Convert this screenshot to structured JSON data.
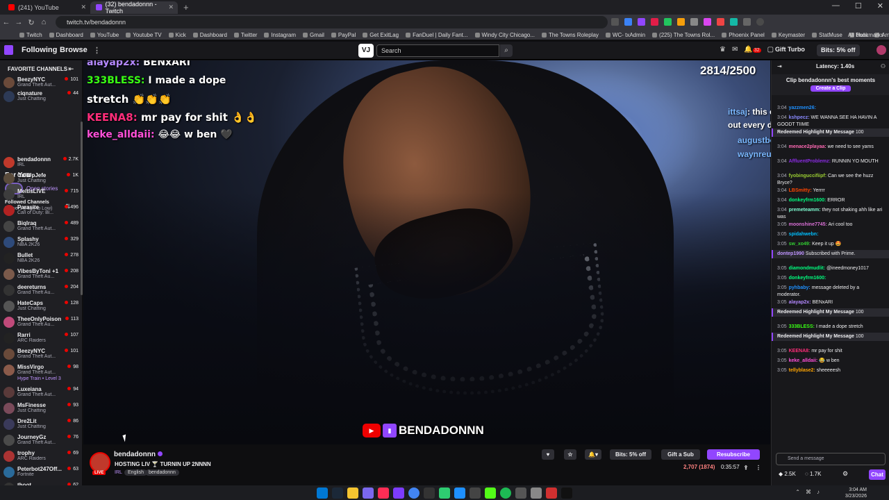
{
  "browser": {
    "tabs": [
      {
        "label": "(241) YouTube",
        "color": "#ff0000"
      },
      {
        "label": "(32) bendadonnn - Twitch",
        "color": "#9146ff"
      }
    ],
    "url": "twitch.tv/bendadonnn",
    "bookmarks": [
      "Twitch",
      "Dashboard",
      "YouTube",
      "Youtube TV",
      "Kick",
      "Dashboard",
      "Twitter",
      "Instagram",
      "Gmail",
      "PayPal",
      "Get ExitLag",
      "FanDuel | Daily Fant...",
      "Windy City Chicago...",
      "The Towns Roleplay",
      "WC- txAdmin",
      "(225) The Towns Rol...",
      "Phoenix Panel",
      "Keymaster",
      "StatMuse",
      "Hulu",
      "Amazon",
      "Venm's Lair: P52 Va..."
    ],
    "all_bookmarks": "All Bookmarks"
  },
  "twitch": {
    "following": "Following",
    "browse": "Browse",
    "search_placeholder": "Search",
    "notif_count": "32",
    "gift_turbo": "Gift Turbo",
    "bits": "Bits: 5% off"
  },
  "sidebar": {
    "favorites_header": "FAVORITE CHANNELS",
    "favorites": [
      {
        "name": "BeezyNYC",
        "game": "Grand Theft Aut...",
        "viewers": "101",
        "color": "#6a4a3a"
      },
      {
        "name": "ciqnature",
        "game": "Just Chatting",
        "viewers": "44",
        "color": "#2d3a56"
      }
    ],
    "for_you": "For You",
    "open_stories": "Open stories",
    "followed_header": "Followed Channels",
    "followed_sort": "Viewers (High to Low)",
    "channels": [
      {
        "name": "bendadonnn",
        "game": "IRL",
        "viewers": "2.7K",
        "color": "#c0392b"
      },
      {
        "name": "CallUpJefe",
        "game": "Just Chatting",
        "viewers": "1K",
        "color": "#5a4b3b"
      },
      {
        "name": "MeltisLIVE",
        "game": "IRL",
        "viewers": "715",
        "color": "#3d3d3d"
      },
      {
        "name": "Parasite",
        "game": "Call of Duty: Bl...",
        "viewers": "496",
        "color": "#b22222"
      },
      {
        "name": "Biqlraq",
        "game": "Grand Theft Aut...",
        "viewers": "489",
        "color": "#444"
      },
      {
        "name": "Splashy",
        "game": "NBA 2K26",
        "viewers": "329",
        "color": "#2e4a7a"
      },
      {
        "name": "Bullet",
        "game": "NBA 2K26",
        "viewers": "278",
        "color": "#222"
      },
      {
        "name": "VibesByToni +1",
        "game": "Grand Theft Au...",
        "viewers": "208",
        "color": "#7b5a4b"
      },
      {
        "name": "deereturns",
        "game": "Grand Theft Au...",
        "viewers": "204",
        "color": "#333"
      },
      {
        "name": "HateCaps",
        "game": "Just Chatting",
        "viewers": "128",
        "color": "#555"
      },
      {
        "name": "TheeOnlyPoison",
        "game": "Grand Theft Au...",
        "viewers": "113",
        "color": "#c04a7a"
      },
      {
        "name": "Rarri",
        "game": "ARC Raiders",
        "viewers": "107",
        "color": "#222"
      },
      {
        "name": "BeezyNYC",
        "game": "Grand Theft Aut...",
        "viewers": "101",
        "color": "#6a4a3a"
      },
      {
        "name": "MissVirgo",
        "game": "Grand Theft Aut...",
        "viewers": "98",
        "color": "#8a5a4a",
        "hype": "Hype Train • Level 3"
      },
      {
        "name": "Luxeiana",
        "game": "Grand Theft Aut...",
        "viewers": "94",
        "color": "#5a3a3a"
      },
      {
        "name": "MsFinesse",
        "game": "Just Chatting",
        "viewers": "93",
        "color": "#7a4a5a"
      },
      {
        "name": "Dre2Lit",
        "game": "Just Chatting",
        "viewers": "86",
        "color": "#3a3a5a"
      },
      {
        "name": "JourneyGz",
        "game": "Grand Theft Aut...",
        "viewers": "76",
        "color": "#4a4a4a"
      },
      {
        "name": "trophy",
        "game": "ARC Raiders",
        "viewers": "69",
        "color": "#aa3333"
      },
      {
        "name": "Peterbot247Off...",
        "game": "Fortnite",
        "viewers": "63",
        "color": "#2a6a9a"
      },
      {
        "name": "thoot",
        "game": "",
        "viewers": "62",
        "color": "#333"
      }
    ]
  },
  "video": {
    "counter": "2814/2500",
    "overlay_chat": [
      {
        "user": "alayap2x:",
        "msg": "BENxARI",
        "ucolor": "#b388ff"
      },
      {
        "user": "333BLESS:",
        "msg": "I made a dope",
        "ucolor": "#39ff14"
      },
      {
        "user": "",
        "msg": "stretch 👏👏👏",
        "ucolor": "#fff"
      },
      {
        "user": "KEENA8:",
        "msg": "mr pay for shit 👌👌",
        "ucolor": "#ff2d7a"
      },
      {
        "user": "keke_alldaii:",
        "msg": "😂😂 w ben 🖤",
        "ucolor": "#ff4fd8"
      }
    ],
    "right_overlay": [
      {
        "user": "ittsaj",
        "msg": ": this old nigga know he be"
      },
      {
        "user": "",
        "msg": "out every day"
      },
      {
        "user": "augustbourne",
        "msg": ": 😂"
      },
      {
        "user": "waynreup",
        "msg": ""
      }
    ],
    "watermark": "BENDADONNN"
  },
  "stream": {
    "channel": "bendadonnn",
    "live": "LIVE",
    "title": "HOSTING LIV 🍸 TURNIN UP 2NNNN",
    "category": "IRL",
    "tags": [
      "English",
      "bendadonnn"
    ],
    "bits": "Bits: 5% off",
    "gift": "Gift a Sub",
    "resubscribe": "Resubscribe",
    "viewers": "2,707 (1874)",
    "uptime": "0:35:57"
  },
  "chat": {
    "latency": "Latency: 1.40s",
    "clip_title": "Clip bendadonnn's best moments",
    "create_clip": "Create a Clip",
    "messages": [
      {
        "t": "3:04",
        "u": "yazzmen26:",
        "m": "",
        "c": "#1e90ff"
      },
      {
        "t": "3:04",
        "u": "kshpecz:",
        "m": "WE WANNA SEE HA HAVIN A GOODT TIIME",
        "c": "#8a8aff"
      },
      {
        "t": "",
        "u": "Redeemed Highlight My Message",
        "m": "100",
        "c": "#efeff1",
        "hl": true
      },
      {
        "t": "3:04",
        "u": "menace2playaa:",
        "m": "we need to see yams",
        "c": "#ff69b4"
      },
      {
        "t": "3:04",
        "u": "AffluentProblemz:",
        "m": "RUNNIN YO MOUTH",
        "c": "#8a2be2"
      },
      {
        "t": "3:04",
        "u": "fyobinguccifiipf:",
        "m": "Can we see the huzz Bryce?",
        "c": "#9acd32"
      },
      {
        "t": "3:04",
        "u": "LBSmitty:",
        "m": "Yerrrr",
        "c": "#ff4500"
      },
      {
        "t": "3:04",
        "u": "donkeyfrm1600:",
        "m": "ERROR",
        "c": "#00ff7f"
      },
      {
        "t": "3:04",
        "u": "premeteamm:",
        "m": "they not shaking ahh like ari was",
        "c": "#7fffd4"
      },
      {
        "t": "3:05",
        "u": "moonshine7745:",
        "m": "Ari cool too",
        "c": "#da70d6"
      },
      {
        "t": "3:05",
        "u": "spidahwebn:",
        "m": "",
        "c": "#00bfff"
      },
      {
        "t": "3:05",
        "u": "sw_xo49:",
        "m": "Keep it up 🤩",
        "c": "#32cd32"
      },
      {
        "t": "",
        "u": "dontep1990",
        "m": "Subscribed with Prime.",
        "c": "#bf94ff",
        "hl": true
      },
      {
        "t": "3:05",
        "u": "diamondmudlit:",
        "m": "@ineedmoney1017",
        "c": "#00ff7f"
      },
      {
        "t": "3:05",
        "u": "donkeyfrm1600:",
        "m": "",
        "c": "#00ff7f"
      },
      {
        "t": "3:05",
        "u": "pyhbaby:",
        "m": "message deleted by a moderator.",
        "c": "#1e90ff"
      },
      {
        "t": "3:05",
        "u": "alayap2x:",
        "m": "BENxARI",
        "c": "#b388ff"
      },
      {
        "t": "",
        "u": "Redeemed Highlight My Message",
        "m": "100",
        "c": "#efeff1",
        "hl": true
      },
      {
        "t": "3:05",
        "u": "333BLESS:",
        "m": "I made a dope stretch",
        "c": "#39ff14"
      },
      {
        "t": "",
        "u": "Redeemed Highlight My Message",
        "m": "100",
        "c": "#efeff1",
        "hl": true
      },
      {
        "t": "3:05",
        "u": "KEENA8:",
        "m": "mr pay for shit",
        "c": "#ff2d7a"
      },
      {
        "t": "3:05",
        "u": "keke_alldaii:",
        "m": "😂 w ben",
        "c": "#ff4fd8"
      },
      {
        "t": "3:05",
        "u": "tellyblase2:",
        "m": "sheeeeesh",
        "c": "#ffa500"
      }
    ],
    "send_placeholder": "Send a message",
    "points": "2.5K",
    "points2": "1.7K",
    "chat_btn": "Chat"
  },
  "taskbar": {
    "time": "3:04 AM",
    "date": "3/23/2026"
  }
}
